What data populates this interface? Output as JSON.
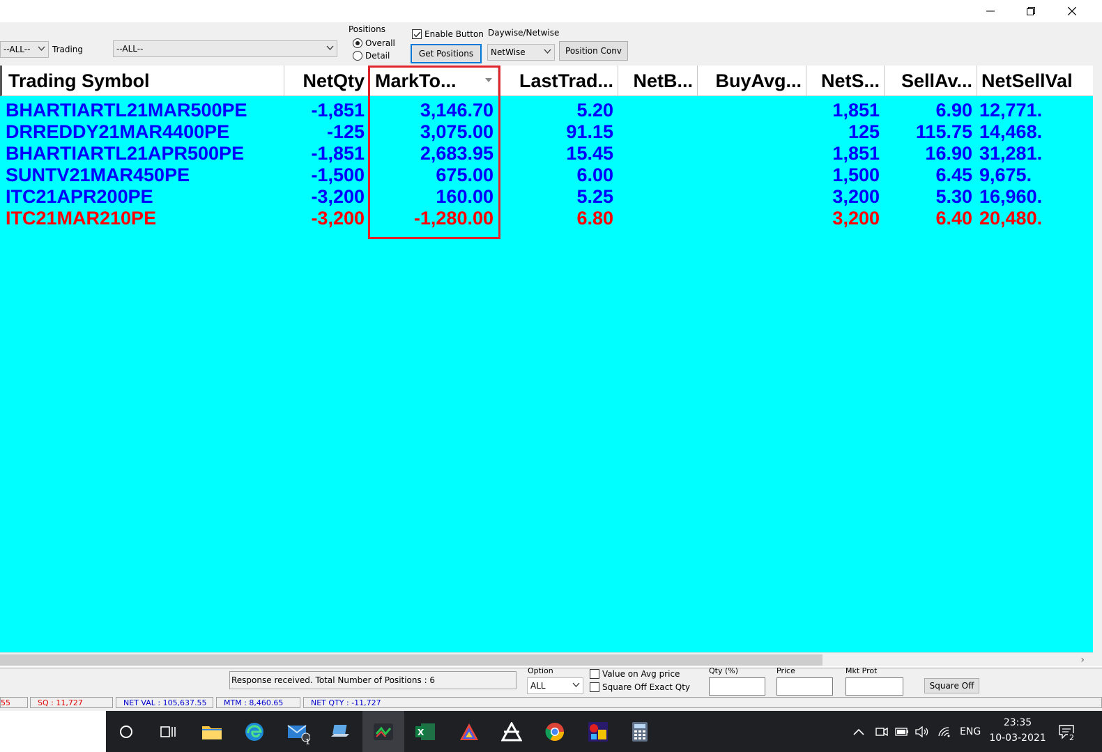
{
  "toolbar": {
    "exchange_filter": "--ALL--",
    "trading_label": "Trading",
    "trading_filter": "--ALL--",
    "positions_group_label": "Positions",
    "radio_overall": "Overall",
    "radio_detail": "Detail",
    "enable_button_label": "Enable Button",
    "get_positions_label": "Get Positions",
    "daywise_label": "Daywise/Netwise",
    "daywise_value": "NetWise",
    "position_conv_label": "Position Conv"
  },
  "grid": {
    "columns": [
      "Trading Symbol",
      "NetQty",
      "MarkTo...",
      "LastTrad...",
      "NetB...",
      "BuyAvg...",
      "NetS...",
      "SellAv...",
      "NetSellVal"
    ],
    "rows": [
      {
        "symbol": "BHARTIARTL21MAR500PE",
        "netqty": "-1,851",
        "mtm": "3,146.70",
        "ltp": "5.20",
        "netb": "",
        "buyavg": "",
        "nets": "1,851",
        "sellavg": "6.90",
        "netsellval": "12,771.",
        "color": "#0000ff"
      },
      {
        "symbol": "DRREDDY21MAR4400PE",
        "netqty": "-125",
        "mtm": "3,075.00",
        "ltp": "91.15",
        "netb": "",
        "buyavg": "",
        "nets": "125",
        "sellavg": "115.75",
        "netsellval": "14,468.",
        "color": "#0000ff"
      },
      {
        "symbol": "BHARTIARTL21APR500PE",
        "netqty": "-1,851",
        "mtm": "2,683.95",
        "ltp": "15.45",
        "netb": "",
        "buyavg": "",
        "nets": "1,851",
        "sellavg": "16.90",
        "netsellval": "31,281.",
        "color": "#0000ff"
      },
      {
        "symbol": "SUNTV21MAR450PE",
        "netqty": "-1,500",
        "mtm": "675.00",
        "ltp": "6.00",
        "netb": "",
        "buyavg": "",
        "nets": "1,500",
        "sellavg": "6.45",
        "netsellval": "9,675.",
        "color": "#0000ff"
      },
      {
        "symbol": "ITC21APR200PE",
        "netqty": "-3,200",
        "mtm": "160.00",
        "ltp": "5.25",
        "netb": "",
        "buyavg": "",
        "nets": "3,200",
        "sellavg": "5.30",
        "netsellval": "16,960.",
        "color": "#0000ff"
      },
      {
        "symbol": "ITC21MAR210PE",
        "netqty": "-3,200",
        "mtm": "-1,280.00",
        "ltp": "6.80",
        "netb": "",
        "buyavg": "",
        "nets": "3,200",
        "sellavg": "6.40",
        "netsellval": "20,480.",
        "color": "#ff0000"
      }
    ]
  },
  "bottom": {
    "status_text": "Response received.  Total Number of Positions : 6",
    "option_label": "Option",
    "option_value": "ALL",
    "value_on_avg_label": "Value on Avg  price",
    "square_off_exact_label": "Square Off Exact Qty",
    "qty_label": "Qty (%)",
    "price_label": "Price",
    "mkt_prot_label": "Mkt Prot",
    "square_off_button": "Square Off",
    "bars": {
      "first": "55",
      "sq": "SQ : 11,727",
      "net_val": "NET VAL : 105,637.55",
      "mtm": "MTM : 8,460.65",
      "net_qty": "NET QTY : -11,727"
    }
  },
  "taskbar": {
    "mail_badge": "1",
    "language": "ENG",
    "time": "23:35",
    "date": "10-03-2021",
    "notification_count": "2"
  },
  "colors": {
    "grid_bg": "#00ffff",
    "profit_text": "#0000ff",
    "loss_text": "#ff0000",
    "highlight_border": "#e0242c"
  }
}
